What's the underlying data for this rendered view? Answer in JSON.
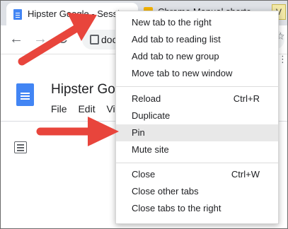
{
  "browser": {
    "active_tab_title": "Hipster Google - Sessi",
    "close_glyph": "×",
    "second_tab_title": "Chrome Manual shortc",
    "third_tab_letter": "V",
    "omnibox_text": "doc",
    "back_glyph": "←",
    "forward_glyph": "→",
    "reload_glyph": "C",
    "star_glyph": "☆",
    "kebab_glyph": "⋮"
  },
  "document": {
    "title": "Hipster Google",
    "menu": [
      "File",
      "Edit",
      "Vi"
    ]
  },
  "context_menu": {
    "groups": [
      [
        {
          "label": "New tab to the right",
          "shortcut": ""
        },
        {
          "label": "Add tab to reading list",
          "shortcut": ""
        },
        {
          "label": "Add tab to new group",
          "shortcut": ""
        },
        {
          "label": "Move tab to new window",
          "shortcut": ""
        }
      ],
      [
        {
          "label": "Reload",
          "shortcut": "Ctrl+R"
        },
        {
          "label": "Duplicate",
          "shortcut": ""
        },
        {
          "label": "Pin",
          "shortcut": "",
          "highlighted": true
        },
        {
          "label": "Mute site",
          "shortcut": ""
        }
      ],
      [
        {
          "label": "Close",
          "shortcut": "Ctrl+W"
        },
        {
          "label": "Close other tabs",
          "shortcut": ""
        },
        {
          "label": "Close tabs to the right",
          "shortcut": ""
        }
      ]
    ]
  },
  "colors": {
    "annotation_arrow": "#e8453c",
    "menu_highlight": "#e8e8e8",
    "docs_blue": "#4285f4"
  }
}
